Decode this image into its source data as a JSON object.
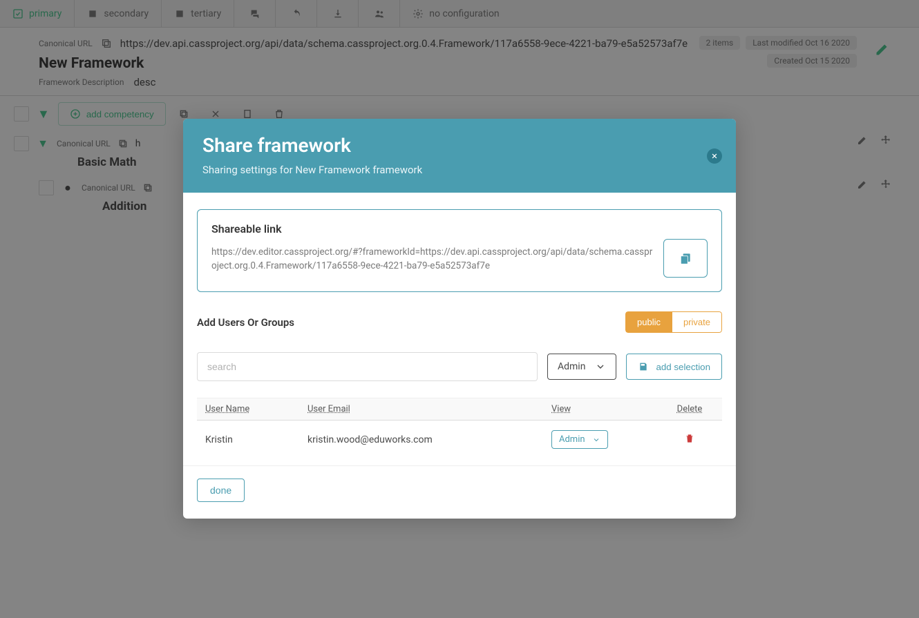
{
  "toolbar": {
    "tabs": [
      "primary",
      "secondary",
      "tertiary"
    ],
    "config_label": "no configuration"
  },
  "framework": {
    "canonical_label": "Canonical URL",
    "canonical_url": "https://dev.api.cassproject.org/api/data/schema.cassproject.org.0.4.Framework/117a6558-9ece-4221-ba79-e5a52573af7e",
    "title": "New Framework",
    "desc_label": "Framework Description",
    "desc": "desc",
    "items_badge": "2 items",
    "modified_badge": "Last modified Oct 16 2020",
    "created_badge": "Created Oct 15 2020",
    "add_comp_label": "add competency"
  },
  "hierarchy": [
    {
      "canonical_label": "Canonical URL",
      "url_prefix": "h",
      "title": "Basic Math"
    },
    {
      "canonical_label": "Canonical URL",
      "url_prefix": "",
      "title": "Addition"
    }
  ],
  "modal": {
    "title": "Share framework",
    "subtitle": "Sharing settings for New Framework framework",
    "share_label": "Shareable link",
    "share_url": "https://dev.editor.cassproject.org/#?frameworkId=https://dev.api.cassproject.org/api/data/schema.cassproject.org.0.4.Framework/117a6558-9ece-4221-ba79-e5a52573af7e",
    "add_users_label": "Add Users Or Groups",
    "public_label": "public",
    "private_label": "private",
    "search_placeholder": "search",
    "role_select": "Admin",
    "add_selection_label": "add selection",
    "columns": {
      "name": "User Name",
      "email": "User Email",
      "view": "View",
      "delete": "Delete"
    },
    "rows": [
      {
        "name": "Kristin",
        "email": "kristin.wood@eduworks.com",
        "role": "Admin"
      }
    ],
    "done_label": "done"
  }
}
